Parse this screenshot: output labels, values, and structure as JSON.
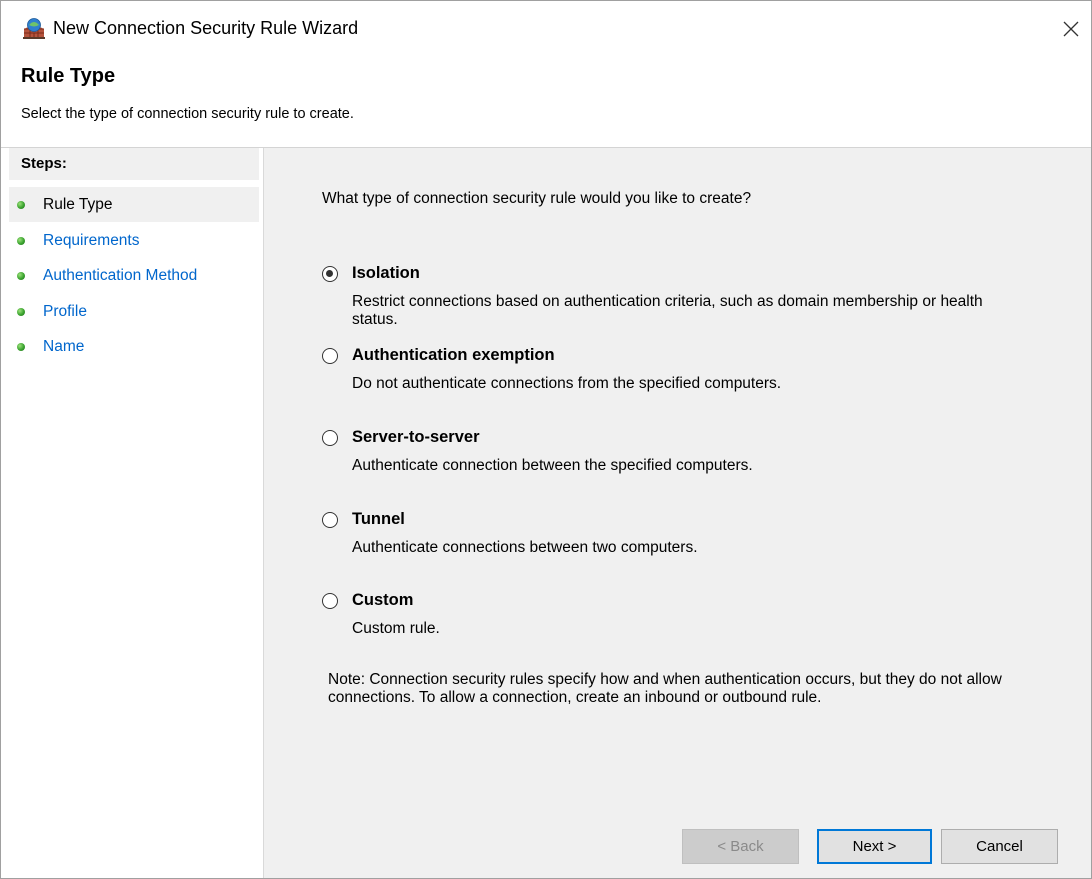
{
  "window": {
    "title": "New Connection Security Rule Wizard",
    "app_icon": "firewall-wizard-icon",
    "close_icon": "close-icon"
  },
  "header": {
    "title": "Rule Type",
    "subtitle": "Select the type of connection security rule to create."
  },
  "steps": {
    "header": "Steps:",
    "items": [
      {
        "label": "Rule Type",
        "state": "current"
      },
      {
        "label": "Requirements",
        "state": "link"
      },
      {
        "label": "Authentication Method",
        "state": "link"
      },
      {
        "label": "Profile",
        "state": "link"
      },
      {
        "label": "Name",
        "state": "link"
      }
    ]
  },
  "content": {
    "question": "What type of connection security rule would you like to create?",
    "options": [
      {
        "label": "Isolation",
        "description": "Restrict connections based on authentication criteria, such as domain membership or health status.",
        "selected": true
      },
      {
        "label": "Authentication exemption",
        "description": "Do not authenticate connections from the specified computers.",
        "selected": false
      },
      {
        "label": "Server-to-server",
        "description": "Authenticate connection between the specified computers.",
        "selected": false
      },
      {
        "label": "Tunnel",
        "description": "Authenticate connections between two computers.",
        "selected": false
      },
      {
        "label": "Custom",
        "description": "Custom rule.",
        "selected": false
      }
    ],
    "note": "Note:  Connection security rules specify how and when authentication occurs, but they do not allow connections.  To allow a connection, create an inbound or outbound rule."
  },
  "buttons": {
    "back": "< Back",
    "next": "Next >",
    "cancel": "Cancel"
  },
  "colors": {
    "link": "#0066cc",
    "panel": "#f0f0f0",
    "focus": "#0078d7",
    "step_dot": "#3aa32f"
  }
}
